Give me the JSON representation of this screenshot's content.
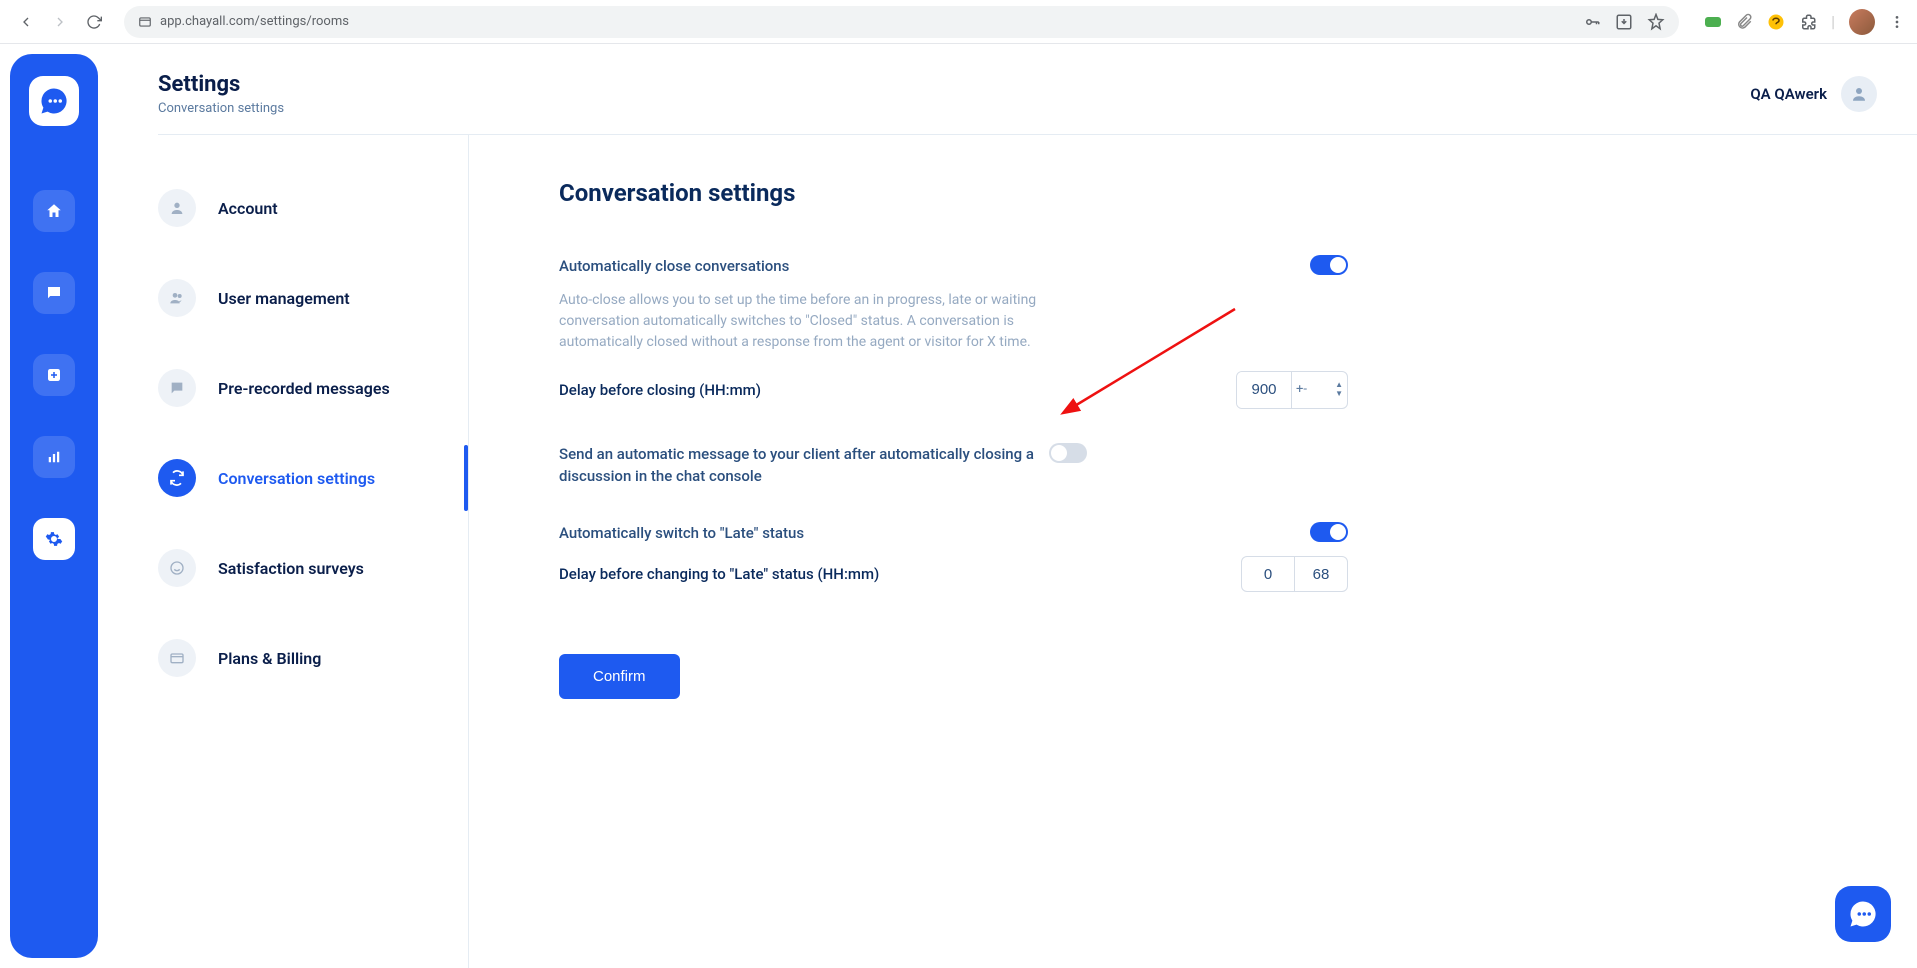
{
  "browser": {
    "url": "app.chayall.com/settings/rooms"
  },
  "header": {
    "title": "Settings",
    "subtitle": "Conversation settings",
    "user_name": "QA QAwerk"
  },
  "nav": {
    "items": [
      {
        "label": "Account"
      },
      {
        "label": "User management"
      },
      {
        "label": "Pre-recorded messages"
      },
      {
        "label": "Conversation settings"
      },
      {
        "label": "Satisfaction surveys"
      },
      {
        "label": "Plans & Billing"
      }
    ]
  },
  "panel": {
    "title": "Conversation settings",
    "auto_close": {
      "label": "Automatically close conversations",
      "description": "Auto-close allows you to set up the time before an in progress, late or waiting conversation automatically switches to \"Closed\" status. A conversation is automatically closed without a response from the agent or visitor for X time.",
      "enabled": true,
      "delay_label": "Delay before closing (HH:mm)",
      "delay_value": "900",
      "stepper_text": "+-"
    },
    "auto_message": {
      "label": "Send an automatic message to your client after automatically closing a discussion in the chat console",
      "enabled": false
    },
    "late_status": {
      "label": "Automatically switch to \"Late\" status",
      "enabled": true,
      "delay_label": "Delay before changing to \"Late\" status (HH:mm)",
      "hh": "0",
      "mm": "68"
    },
    "confirm": "Confirm"
  },
  "colors": {
    "primary": "#1e5af0"
  }
}
